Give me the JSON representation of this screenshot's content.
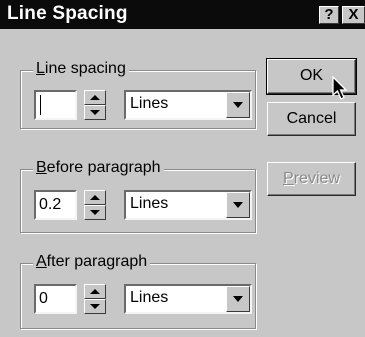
{
  "window": {
    "title": "Line Spacing",
    "help_label": "?",
    "close_label": "X"
  },
  "line_spacing": {
    "label_accel": "L",
    "label_rest": "ine spacing",
    "value": "",
    "unit": "Lines"
  },
  "before_paragraph": {
    "label_accel": "B",
    "label_rest": "efore paragraph",
    "value": "0.2",
    "unit": "Lines"
  },
  "after_paragraph": {
    "label_accel": "A",
    "label_rest": "fter paragraph",
    "value": "0",
    "unit": "Lines"
  },
  "buttons": {
    "ok": "OK",
    "cancel": "Cancel",
    "preview_accel": "P",
    "preview_rest": "review"
  },
  "icons": {
    "cursor": "mouse-pointer-icon"
  },
  "colors": {
    "title_bar": "#0b0b0b",
    "dialog_bg": "#c7c7c7",
    "disabled_text": "#8a8a8a"
  }
}
